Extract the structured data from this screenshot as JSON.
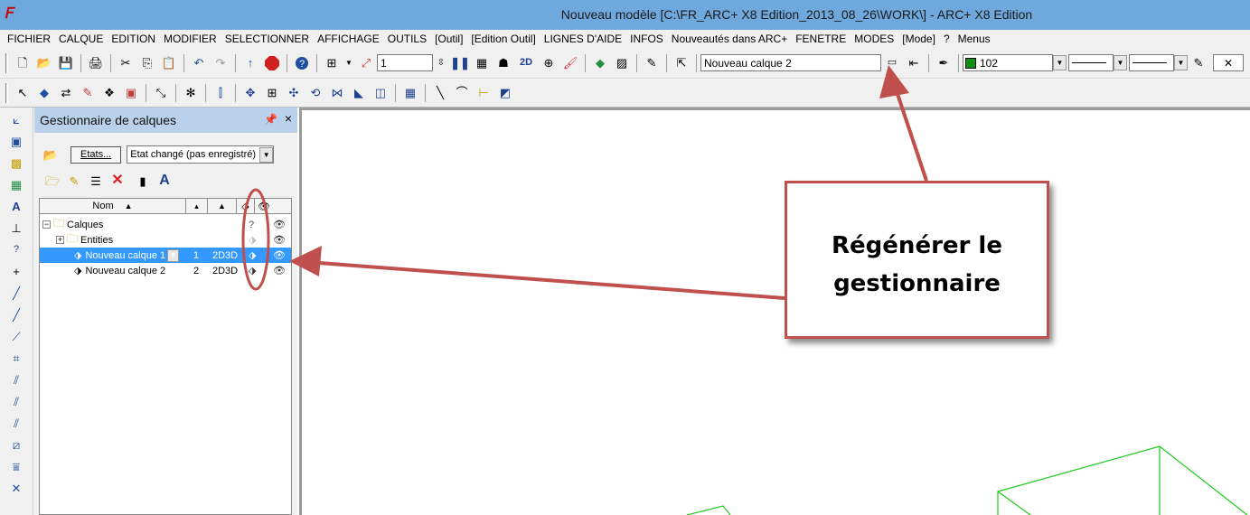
{
  "window": {
    "title": "Nouveau modèle [C:\\FR_ARC+ X8 Edition_2013_08_26\\WORK\\] - ARC+ X8 Edition",
    "app_icon": "arc-logo-icon"
  },
  "menu": [
    "FICHIER",
    "CALQUE",
    "EDITION",
    "MODIFIER",
    "SELECTIONNER",
    "AFFICHAGE",
    "OUTILS",
    "[Outil]",
    "[Edition Outil]",
    "LIGNES D'AIDE",
    "INFOS",
    "Nouveautés dans ARC+",
    "FENETRE",
    "MODES",
    "[Mode]",
    "?",
    "Menus"
  ],
  "toolbar": {
    "scale_value": "1",
    "mode_2d": "2D",
    "current_layer": "Nouveau calque 2",
    "color_value": "102",
    "color_swatch": "#109010"
  },
  "layer_manager": {
    "title": "Gestionnaire de calques",
    "pin": "ᵖ",
    "close": "×",
    "etats_button": "Etats...",
    "state_select": "Etat changé (pas enregistré)",
    "columns": {
      "name": "Nom"
    },
    "tree": {
      "root": "Calques",
      "group": "Entities",
      "layers": [
        {
          "name": "Nouveau calque 1",
          "number": "1",
          "mode": "2D3D",
          "selected": true
        },
        {
          "name": "Nouveau calque 2",
          "number": "2",
          "mode": "2D3D",
          "selected": false
        }
      ]
    }
  },
  "callout": {
    "line1": "Régénérer le",
    "line2": "gestionnaire",
    "border_color": "#c0504d"
  },
  "canvas": {
    "line_color": "#1ec81e"
  }
}
